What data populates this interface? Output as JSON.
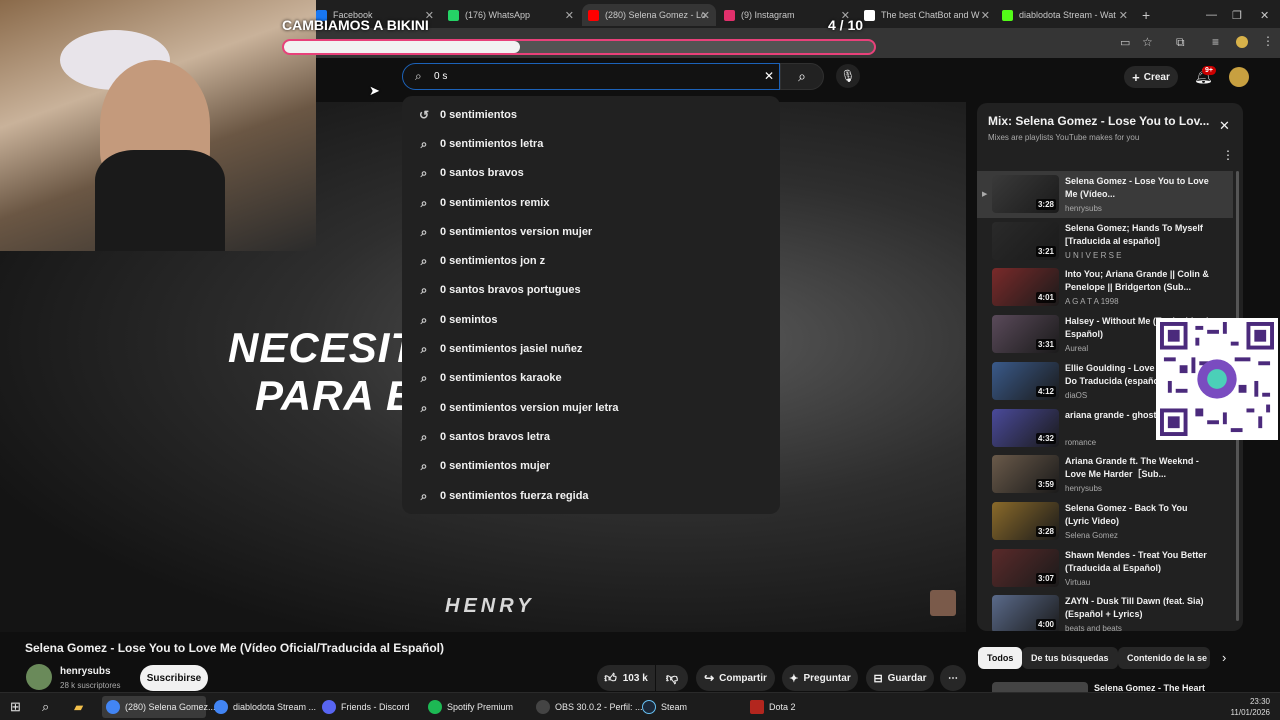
{
  "browser": {
    "tabs": [
      {
        "label": "Facebook",
        "color": "#1877f2"
      },
      {
        "label": "(176) WhatsApp",
        "color": "#25d366"
      },
      {
        "label": "(280) Selena Gomez - Lo",
        "color": "#ff0000"
      },
      {
        "label": "(9) Instagram",
        "color": "#e1306c"
      },
      {
        "label": "The best ChatBot and W",
        "color": "#ffffff"
      },
      {
        "label": "diablodota Stream - Wat",
        "color": "#53fc18"
      }
    ],
    "new_tab": "+"
  },
  "overlay": {
    "goal_text": "CAMBIAMOS A BIKINI",
    "goal_progress_text": "4 / 10",
    "goal_progress_fraction": 0.4,
    "goal_color": "#e8417a"
  },
  "youtube": {
    "search": {
      "value": "0 s"
    },
    "create_label": "Crear",
    "notif_badge": "9+",
    "suggestions": [
      {
        "text": "0 sentimientos",
        "icon": "history-icon"
      },
      {
        "text": "0 sentimientos letra",
        "icon": "search-icon"
      },
      {
        "text": "0 santos bravos",
        "icon": "search-icon"
      },
      {
        "text": "0 sentimientos remix",
        "icon": "search-icon"
      },
      {
        "text": "0 sentimientos version mujer",
        "icon": "search-icon"
      },
      {
        "text": "0 sentimientos jon z",
        "icon": "search-icon"
      },
      {
        "text": "0 santos bravos portugues",
        "icon": "search-icon"
      },
      {
        "text": "0 semintos",
        "icon": "search-icon"
      },
      {
        "text": "0 sentimientos jasiel nuñez",
        "icon": "search-icon"
      },
      {
        "text": "0 sentimientos karaoke",
        "icon": "search-icon"
      },
      {
        "text": "0 sentimientos version mujer letra",
        "icon": "search-icon"
      },
      {
        "text": "0 santos bravos letra",
        "icon": "search-icon"
      },
      {
        "text": "0 sentimientos mujer",
        "icon": "search-icon"
      },
      {
        "text": "0 sentimientos fuerza regida",
        "icon": "search-icon"
      }
    ],
    "video": {
      "overlay_line1": "NECESIT",
      "overlay_line2": "PARA E",
      "watermark": "HENRY",
      "title": "Selena Gomez - Lose You to Love Me (Vídeo Oficial/Traducida al Español)",
      "channel": "henrysubs",
      "subscribers": "28 k suscriptores",
      "subscribe_label": "Suscribirse",
      "likes": "103 k",
      "share_label": "Compartir",
      "ask_label": "Preguntar",
      "save_label": "Guardar"
    },
    "playlist": {
      "title": "Mix: Selena Gomez - Lose You to Lov...",
      "subtitle": "Mixes are playlists YouTube makes for you",
      "items": [
        {
          "title": "Selena Gomez - Lose You to Love Me (Vídeo...",
          "channel": "henrysubs",
          "duration": "3:28"
        },
        {
          "title": "Selena Gomez; Hands To Myself [Traducida al español]",
          "channel": "U N I V E R S E",
          "duration": "3:21"
        },
        {
          "title": "Into You; Ariana Grande || Colin & Penelope || Bridgerton (Sub...",
          "channel": "A G A T A 1998",
          "duration": "4:01"
        },
        {
          "title": "Halsey - Without Me (Traducida al Español)",
          "channel": "Aureal",
          "duration": "3:31"
        },
        {
          "title": "Ellie Goulding - Love Me Like You Do Traducida (español)",
          "channel": "diaOS",
          "duration": "4:12"
        },
        {
          "title": "ariana grande - ghostin (español)",
          "channel": "romance",
          "duration": "4:32"
        },
        {
          "title": "Ariana Grande ft. The Weeknd - Love Me Harder［Sub...",
          "channel": "henrysubs",
          "duration": "3:59"
        },
        {
          "title": "Selena Gomez - Back To You (Lyric Video)",
          "channel": "Selena Gomez",
          "duration": "3:28"
        },
        {
          "title": "Shawn Mendes - Treat You Better (Traducida al Español)",
          "channel": "Virtuau",
          "duration": "3:07"
        },
        {
          "title": "ZAYN - Dusk Till Dawn (feat. Sia) (Español + Lyrics)",
          "channel": "beats and beats",
          "duration": "4:00"
        }
      ]
    },
    "chips": [
      "Todos",
      "De tus búsquedas",
      "Contenido de la se"
    ],
    "next_video_title": "Selena Gomez - The Heart"
  },
  "taskbar": {
    "items": [
      {
        "label": "(280) Selena Gomez...",
        "color": "#4285f4"
      },
      {
        "label": "diablodota Stream ...",
        "color": "#4285f4"
      },
      {
        "label": "Friends - Discord",
        "color": "#5865f2"
      },
      {
        "label": "Spotify Premium",
        "color": "#1db954"
      },
      {
        "label": "OBS 30.0.2 - Perfil: ...",
        "color": "#444444"
      },
      {
        "label": "Steam",
        "color": "#1b2838"
      },
      {
        "label": "Dota 2",
        "color": "#b3261e"
      }
    ],
    "time": "23:30",
    "date": "11/01/2026"
  }
}
